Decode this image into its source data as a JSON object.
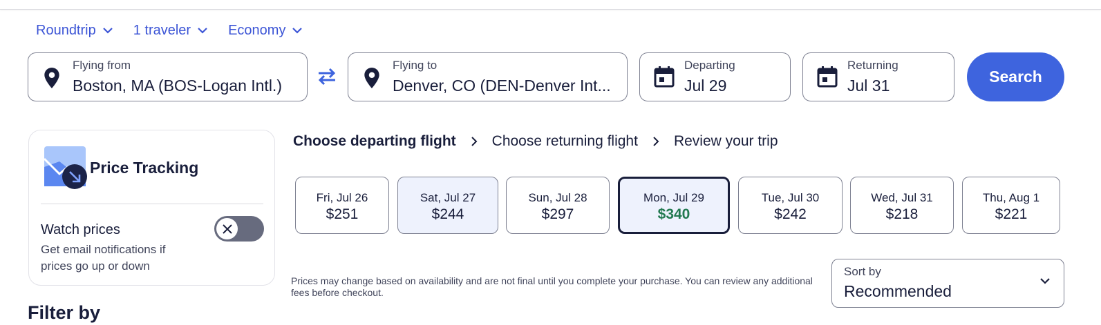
{
  "options": {
    "trip_type": "Roundtrip",
    "travelers": "1 traveler",
    "cabin": "Economy"
  },
  "search": {
    "from_label": "Flying from",
    "from_value": "Boston, MA (BOS-Logan Intl.)",
    "to_label": "Flying to",
    "to_value": "Denver, CO (DEN-Denver Int...",
    "depart_label": "Departing",
    "depart_value": "Jul 29",
    "return_label": "Returning",
    "return_value": "Jul 31",
    "button_label": "Search"
  },
  "price_tracking": {
    "title": "Price Tracking",
    "watch_label": "Watch prices",
    "description": "Get email notifications if prices go up or down",
    "toggle_on": false
  },
  "filter_heading": "Filter by",
  "steps": [
    {
      "label": "Choose departing flight",
      "active": true
    },
    {
      "label": "Choose returning flight",
      "active": false
    },
    {
      "label": "Review your trip",
      "active": false
    }
  ],
  "dates": [
    {
      "day": "Fri, Jul 26",
      "price": "$251",
      "state": "normal"
    },
    {
      "day": "Sat, Jul 27",
      "price": "$244",
      "state": "light"
    },
    {
      "day": "Sun, Jul 28",
      "price": "$297",
      "state": "normal"
    },
    {
      "day": "Mon, Jul 29",
      "price": "$340",
      "state": "selected"
    },
    {
      "day": "Tue, Jul 30",
      "price": "$242",
      "state": "normal"
    },
    {
      "day": "Wed, Jul 31",
      "price": "$218",
      "state": "normal"
    },
    {
      "day": "Thu, Aug 1",
      "price": "$221",
      "state": "normal"
    }
  ],
  "price_note": "Prices may change based on availability and are not final until you complete your purchase. You can review any additional fees before checkout.",
  "sort": {
    "label": "Sort by",
    "value": "Recommended"
  },
  "colors": {
    "accent": "#3e64de",
    "link": "#3c55d6",
    "text": "#191e3b",
    "selected_price": "#227950",
    "selected_bg": "#eef2fd"
  }
}
